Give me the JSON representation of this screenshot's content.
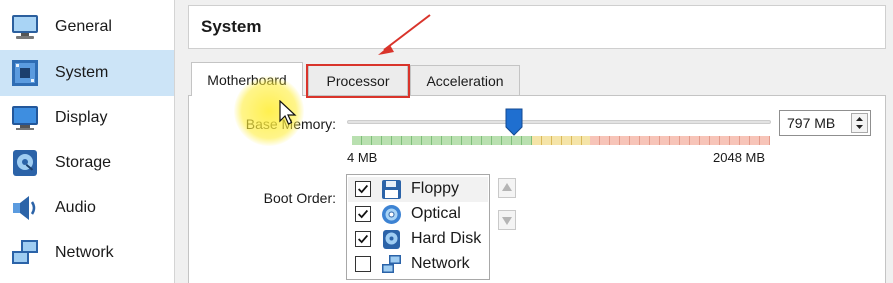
{
  "sidebar": {
    "items": [
      {
        "label": "General",
        "icon": "monitor-icon",
        "selected": false
      },
      {
        "label": "System",
        "icon": "motherboard-icon",
        "selected": true
      },
      {
        "label": "Display",
        "icon": "display-icon",
        "selected": false
      },
      {
        "label": "Storage",
        "icon": "storage-icon",
        "selected": false
      },
      {
        "label": "Audio",
        "icon": "speaker-icon",
        "selected": false
      },
      {
        "label": "Network",
        "icon": "network-icon",
        "selected": false
      }
    ]
  },
  "header": {
    "title": "System"
  },
  "tabs": [
    {
      "label": "Motherboard",
      "active": true
    },
    {
      "label": "Processor",
      "active": false,
      "highlighted": true
    },
    {
      "label": "Acceleration",
      "active": false
    }
  ],
  "motherboard": {
    "base_memory": {
      "label": "Base Memory:",
      "value": "797 MB",
      "value_mb": 797,
      "min_label": "4 MB",
      "max_label": "2048 MB",
      "min_mb": 4,
      "max_mb": 2048
    },
    "boot_order": {
      "label": "Boot Order:",
      "items": [
        {
          "label": "Floppy",
          "checked": true,
          "icon": "floppy-icon"
        },
        {
          "label": "Optical",
          "checked": true,
          "icon": "optical-disc-icon"
        },
        {
          "label": "Hard Disk",
          "checked": true,
          "icon": "hard-disk-icon"
        },
        {
          "label": "Network",
          "checked": false,
          "icon": "network-icon"
        }
      ]
    }
  },
  "colors": {
    "selected_bg": "#cce4f7",
    "highlight_red": "#d9342b",
    "slider_blue": "#1f6fd0",
    "cursor_highlight": "#ffee3c"
  }
}
